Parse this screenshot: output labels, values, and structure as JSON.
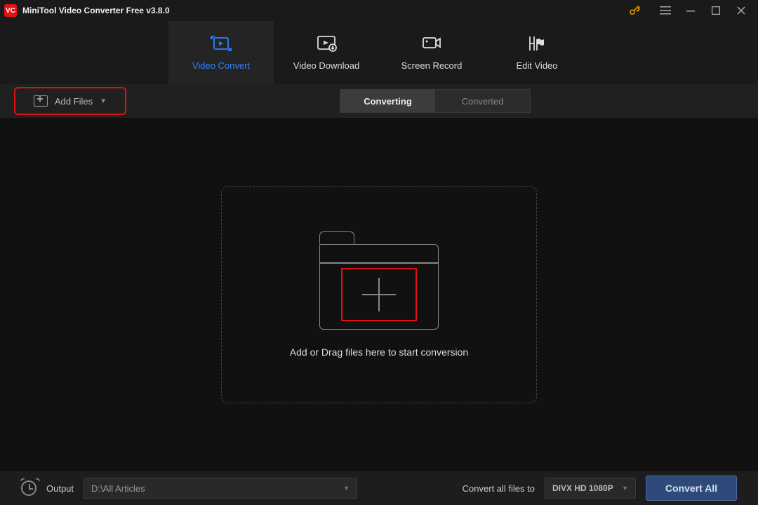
{
  "title": "MiniTool Video Converter Free v3.8.0",
  "logo_text": "VC",
  "nav": {
    "tabs": [
      {
        "label": "Video Convert",
        "active": true
      },
      {
        "label": "Video Download",
        "active": false
      },
      {
        "label": "Screen Record",
        "active": false
      },
      {
        "label": "Edit Video",
        "active": false
      }
    ]
  },
  "toolbar": {
    "add_files_label": "Add Files",
    "subtabs": [
      {
        "label": "Converting",
        "active": true
      },
      {
        "label": "Converted",
        "active": false
      }
    ]
  },
  "dropzone": {
    "message": "Add or Drag files here to start conversion"
  },
  "footer": {
    "output_label": "Output",
    "output_path": "D:\\All Articles",
    "convert_label": "Convert all files to",
    "format": "DIVX HD 1080P",
    "convert_all_label": "Convert All"
  },
  "colors": {
    "accent_red": "#e20f13",
    "accent_blue": "#2e7fff",
    "button_blue": "#2d4a7a"
  }
}
